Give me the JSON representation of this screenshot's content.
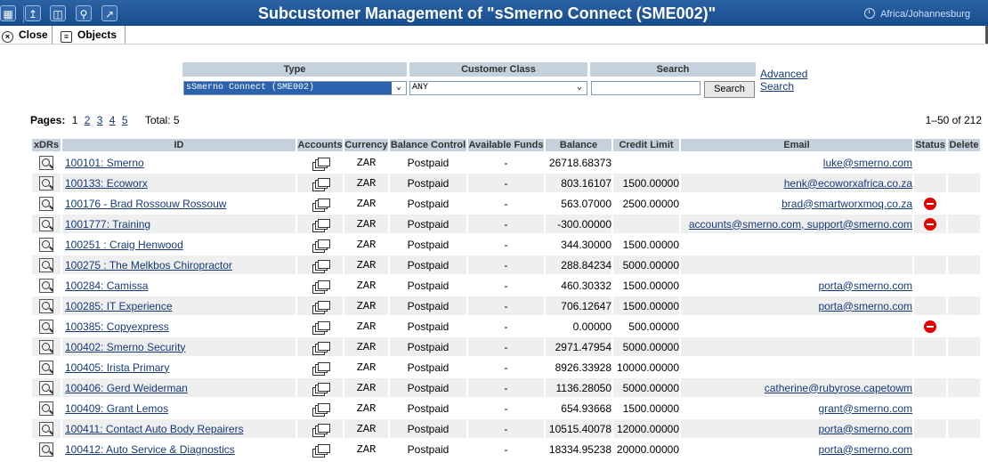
{
  "toolbar": {
    "icons": [
      "grid-icon",
      "upload-icon",
      "tree-icon",
      "search-icon",
      "chart-icon"
    ],
    "title": "Subcustomer Management of \"sSmerno Connect (SME002)\"",
    "timezone": "Africa/Johannesburg",
    "close_label": "Close",
    "objects_label": "Objects"
  },
  "filters": {
    "type_label": "Type",
    "type_value": "sSmerno Connect (SME002)",
    "class_label": "Customer Class",
    "class_value": "ANY",
    "search_label": "Search",
    "search_value": "",
    "search_button": "Search",
    "advanced_line1": "Advanced",
    "advanced_line2": "Search"
  },
  "pagination": {
    "label": "Pages:",
    "current": "1",
    "pages": [
      "2",
      "3",
      "4",
      "5"
    ],
    "total": "Total: 5",
    "range": "1–50 of 212"
  },
  "table": {
    "headers": [
      "xDRs",
      "ID",
      "Accounts",
      "Currency",
      "Balance Control",
      "Available Funds",
      "Balance",
      "Credit Limit",
      "Email",
      "Status",
      "Delete"
    ],
    "rows": [
      {
        "id": "100101: Smerno",
        "currency": "ZAR",
        "control": "Postpaid",
        "funds": "-",
        "balance": "26718.68373",
        "credit": "",
        "email": "luke@smerno.com",
        "status": ""
      },
      {
        "id": "100133: Ecoworx",
        "currency": "ZAR",
        "control": "Postpaid",
        "funds": "-",
        "balance": "803.16107",
        "credit": "1500.00000",
        "email": "henk@ecoworxafrica.co.za",
        "status": ""
      },
      {
        "id": "100176 - Brad Rossouw Rossouw",
        "currency": "ZAR",
        "control": "Postpaid",
        "funds": "-",
        "balance": "563.07000",
        "credit": "2500.00000",
        "email": "brad@smartworxmoq.co.za",
        "status": "blocked"
      },
      {
        "id": "1001777: Training",
        "currency": "ZAR",
        "control": "Postpaid",
        "funds": "-",
        "balance": "-300.00000",
        "credit": "",
        "email": "accounts@smerno.com, support@smerno.com",
        "status": "blocked"
      },
      {
        "id": "100251 : Craig Henwood",
        "currency": "ZAR",
        "control": "Postpaid",
        "funds": "-",
        "balance": "344.30000",
        "credit": "1500.00000",
        "email": "",
        "status": ""
      },
      {
        "id": "100275 : The Melkbos Chiropractor",
        "currency": "ZAR",
        "control": "Postpaid",
        "funds": "-",
        "balance": "288.84234",
        "credit": "5000.00000",
        "email": "",
        "status": ""
      },
      {
        "id": "100284: Camissa",
        "currency": "ZAR",
        "control": "Postpaid",
        "funds": "-",
        "balance": "460.30332",
        "credit": "1500.00000",
        "email": "porta@smerno.com",
        "status": ""
      },
      {
        "id": "100285: IT Experience",
        "currency": "ZAR",
        "control": "Postpaid",
        "funds": "-",
        "balance": "706.12647",
        "credit": "1500.00000",
        "email": "porta@smerno.com",
        "status": ""
      },
      {
        "id": "100385: Copyexpress",
        "currency": "ZAR",
        "control": "Postpaid",
        "funds": "-",
        "balance": "0.00000",
        "credit": "500.00000",
        "email": "",
        "status": "blocked"
      },
      {
        "id": "100402: Smerno Security",
        "currency": "ZAR",
        "control": "Postpaid",
        "funds": "-",
        "balance": "2971.47954",
        "credit": "5000.00000",
        "email": "",
        "status": ""
      },
      {
        "id": "100405: Irista Primary",
        "currency": "ZAR",
        "control": "Postpaid",
        "funds": "-",
        "balance": "8926.33928",
        "credit": "10000.00000",
        "email": "",
        "status": ""
      },
      {
        "id": "100406: Gerd Weiderman",
        "currency": "ZAR",
        "control": "Postpaid",
        "funds": "-",
        "balance": "1136.28050",
        "credit": "5000.00000",
        "email": "catherine@rubyrose.capetowm",
        "status": ""
      },
      {
        "id": "100409: Grant Lemos",
        "currency": "ZAR",
        "control": "Postpaid",
        "funds": "-",
        "balance": "654.93668",
        "credit": "1500.00000",
        "email": "grant@smerno.com",
        "status": ""
      },
      {
        "id": "100411: Contact Auto Body Repairers",
        "currency": "ZAR",
        "control": "Postpaid",
        "funds": "-",
        "balance": "10515.40078",
        "credit": "12000.00000",
        "email": "porta@smerno.com",
        "status": ""
      },
      {
        "id": "100412: Auto Service & Diagnostics",
        "currency": "ZAR",
        "control": "Postpaid",
        "funds": "-",
        "balance": "18334.95238",
        "credit": "20000.00000",
        "email": "porta@smerno.com",
        "status": ""
      }
    ]
  }
}
